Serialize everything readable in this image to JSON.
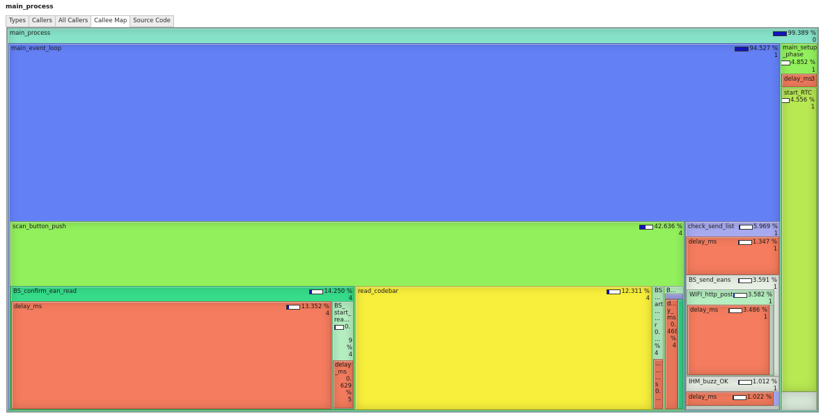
{
  "window_title": "main_process",
  "tabs": [
    {
      "label": "Types"
    },
    {
      "label": "Callers"
    },
    {
      "label": "All Callers"
    },
    {
      "label": "Callee Map",
      "active": true
    },
    {
      "label": "Source Code"
    }
  ],
  "colors": {
    "main_process": "#86e2c8",
    "main_event_loop": "#6480f5",
    "green": "#92f05c",
    "teal": "#36dc8a",
    "red": "#f57c5e",
    "yellow": "#f8ef3c",
    "purple": "#a8aaf0",
    "lime": "#b8e852",
    "light_green": "#b5eec0",
    "light_gray": "#d8e8d8",
    "bar_fill": "#1515b8"
  },
  "map": {
    "main_process": {
      "label": "main_process",
      "pct": "99.389 %",
      "count": "0",
      "fill": 0.99
    },
    "main_event_loop": {
      "label": "main_event_loop",
      "pct": "94.527 %",
      "count": "1",
      "fill": 0.95
    },
    "main_setup_phase": {
      "label": "main_setup\n_phase",
      "pct": "4.852 %",
      "count": "1",
      "fill": 0.05
    },
    "setup_delay_ms": {
      "label": "delay_ms",
      "count": "3"
    },
    "start_RTC": {
      "label": "start_RTC",
      "pct": "4.556 %",
      "count": "1",
      "fill": 0.05
    },
    "scan_button_push": {
      "label": "scan_button_push",
      "pct": "42.636 %",
      "count": "4",
      "fill": 0.43
    },
    "check_send_list": {
      "label": "check_send_list",
      "pct": "5.969 %",
      "count": "1",
      "fill": 0.06
    },
    "check_delay_ms": {
      "label": "delay_ms",
      "pct": "1.347 %",
      "count": "1",
      "fill": 0.02
    },
    "BS_send_eans": {
      "label": "BS_send_eans",
      "pct": "3.591 %",
      "count": "1",
      "fill": 0.04
    },
    "WIFI_http_post": {
      "label": "WIFI_http_post",
      "pct": "3.582 %",
      "count": "1",
      "fill": 0.04
    },
    "wifi_delay_ms": {
      "label": "delay_ms",
      "pct": "3.486 %",
      "count": "1",
      "fill": 0.04
    },
    "IHM_buzz_OK": {
      "label": "IHM_buzz_OK",
      "pct": "1.012 %",
      "count": "1",
      "fill": 0.01
    },
    "ihm_delay_ms": {
      "label": "delay_ms",
      "pct": "1.022 %",
      "fill": 0.01
    },
    "BS_confirm_ean_read": {
      "label": "BS_confirm_ean_read",
      "pct": "14.250 %",
      "count": "4",
      "fill": 0.14
    },
    "confirm_delay_ms": {
      "label": "delay_ms",
      "pct": "13.352 %",
      "count": "4",
      "fill": 0.13
    },
    "BS_start_read": {
      "lines": [
        "BS_",
        "start_",
        "rea..."
      ],
      "pct": "0.",
      "count_lines": [
        "9",
        "%",
        "4"
      ],
      "fill": 0.01
    },
    "bs_start_delay_ms": {
      "lines": [
        "delay",
        "_ms",
        "0.",
        "629",
        "%",
        "5"
      ]
    },
    "read_codebar": {
      "label": "read_codebar",
      "pct": "12.311 %",
      "count": "4",
      "fill": 0.12
    },
    "narrow_a": {
      "lines": [
        "BS",
        "...",
        "art",
        "...",
        "...",
        "r",
        "0.",
        "...",
        "%",
        "4"
      ]
    },
    "narrow_a_red": {
      "lines": [
        "...",
        "...",
        "...",
        "s",
        "0.",
        "..."
      ]
    },
    "narrow_b": {
      "lines": [
        "B...",
        "",
        "d...",
        "y_",
        "ms",
        "0.",
        "468",
        "%",
        "4"
      ]
    }
  }
}
